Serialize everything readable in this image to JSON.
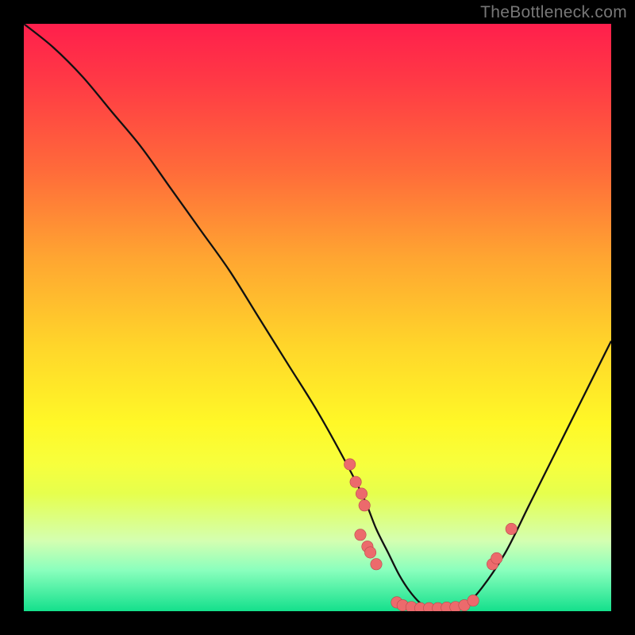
{
  "watermark": "TheBottleneck.com",
  "colors": {
    "curve_stroke": "#111111",
    "point_fill": "#ec6a6c",
    "point_stroke": "#b94a4c"
  },
  "chart_data": {
    "type": "line",
    "title": "",
    "xlabel": "",
    "ylabel": "",
    "xlim": [
      0,
      100
    ],
    "ylim": [
      0,
      100
    ],
    "series": [
      {
        "name": "curve",
        "x": [
          0,
          5,
          10,
          15,
          20,
          25,
          30,
          35,
          40,
          45,
          50,
          55,
          58,
          60,
          62,
          64,
          66,
          68,
          70,
          72,
          75,
          78,
          82,
          86,
          90,
          95,
          100
        ],
        "y": [
          100,
          96,
          91,
          85,
          79,
          72,
          65,
          58,
          50,
          42,
          34,
          25,
          19,
          14,
          10,
          6,
          3,
          1,
          0.5,
          0.5,
          1,
          4,
          10,
          18,
          26,
          36,
          46
        ]
      }
    ],
    "points": [
      {
        "x": 55.5,
        "y": 25
      },
      {
        "x": 56.5,
        "y": 22
      },
      {
        "x": 57.5,
        "y": 20
      },
      {
        "x": 58.0,
        "y": 18
      },
      {
        "x": 57.3,
        "y": 13
      },
      {
        "x": 58.5,
        "y": 11
      },
      {
        "x": 59.0,
        "y": 10
      },
      {
        "x": 60.0,
        "y": 8
      },
      {
        "x": 63.5,
        "y": 1.5
      },
      {
        "x": 64.5,
        "y": 1.0
      },
      {
        "x": 66.0,
        "y": 0.7
      },
      {
        "x": 67.5,
        "y": 0.5
      },
      {
        "x": 69.0,
        "y": 0.5
      },
      {
        "x": 70.5,
        "y": 0.5
      },
      {
        "x": 72.0,
        "y": 0.6
      },
      {
        "x": 73.5,
        "y": 0.7
      },
      {
        "x": 75.0,
        "y": 1.0
      },
      {
        "x": 76.5,
        "y": 1.8
      },
      {
        "x": 79.8,
        "y": 8.0
      },
      {
        "x": 80.5,
        "y": 9.0
      },
      {
        "x": 83.0,
        "y": 14.0
      }
    ]
  }
}
